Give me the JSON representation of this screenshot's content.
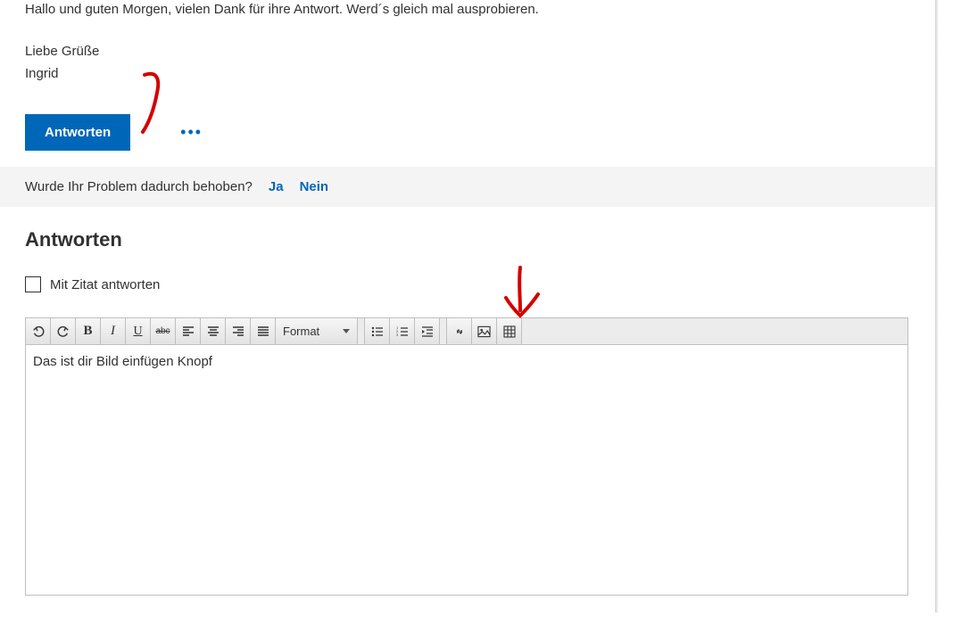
{
  "message": {
    "greeting": "Hallo und guten Morgen, vielen Dank für ihre Antwort. Werd´s gleich mal ausprobieren.",
    "closing": "Liebe Grüße",
    "signature": "Ingrid"
  },
  "actions": {
    "reply_label": "Antworten"
  },
  "feedback": {
    "question": "Wurde Ihr Problem dadurch behoben?",
    "yes": "Ja",
    "no": "Nein"
  },
  "reply_section": {
    "heading": "Antworten",
    "quote_label": "Mit Zitat antworten"
  },
  "editor": {
    "format_label": "Format",
    "content": "Das ist dir Bild einfügen Knopf"
  }
}
